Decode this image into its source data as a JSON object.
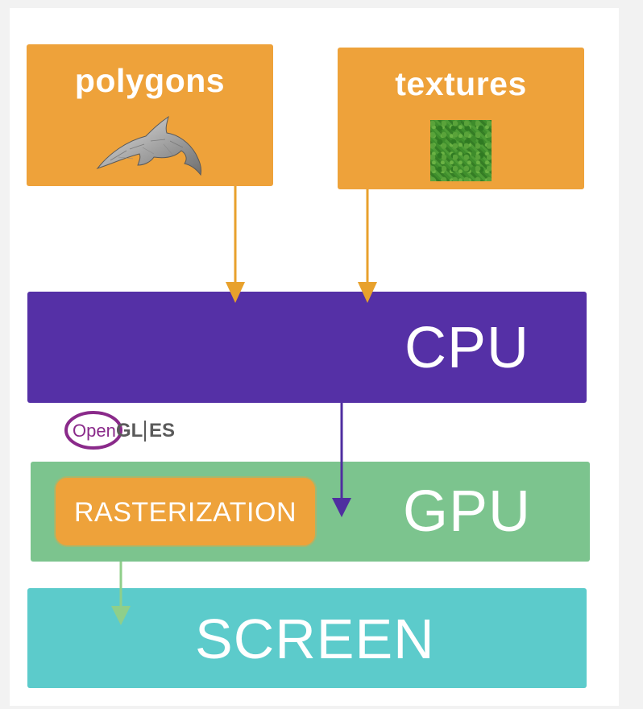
{
  "diagram": {
    "polygons": {
      "title": "polygons"
    },
    "textures": {
      "title": "textures"
    },
    "cpu": {
      "label": "CPU"
    },
    "gpu": {
      "label": "GPU"
    },
    "rasterization": {
      "label": "RASTERIZATION"
    },
    "screen": {
      "label": "SCREEN"
    },
    "logo": {
      "left": "Open",
      "mid": "GL",
      "right": "ES"
    }
  },
  "colors": {
    "orange": "#eea23a",
    "purple": "#5530a6",
    "green": "#7cc48e",
    "cyan": "#5ccbcb",
    "arrow_orange": "#e8a12c",
    "arrow_purple": "#4f2ea0",
    "arrow_green": "#8fcf8a",
    "logo_purple": "#8a2a8a"
  },
  "icons": [
    "dolphin-icon",
    "grass-texture-icon",
    "opengl-es-logo"
  ]
}
